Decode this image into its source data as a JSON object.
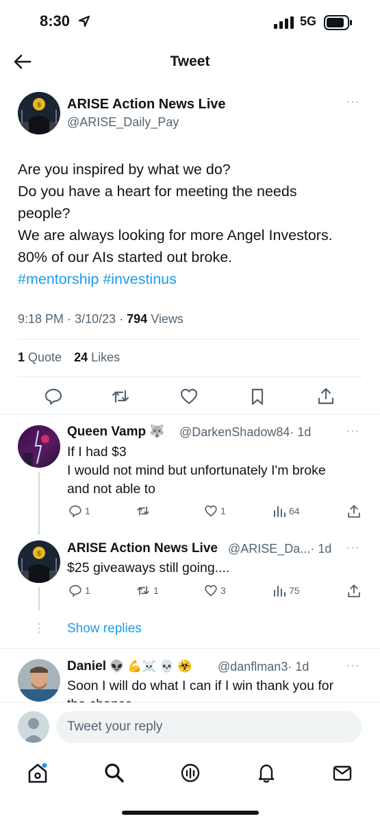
{
  "status_bar": {
    "time": "8:30",
    "network": "5G"
  },
  "header": {
    "title": "Tweet"
  },
  "tweet": {
    "author_name": "ARISE Action News Live",
    "author_handle": "@ARISE_Daily_Pay",
    "lines": [
      "Are you inspired by what we do?",
      "Do you have a heart for meeting the needs",
      "people?",
      "We are always looking for more Angel Investors.",
      "80% of our AIs started out broke."
    ],
    "hashtags": [
      "#mentorship",
      "#investinus"
    ],
    "time": "9:18 PM",
    "date": "3/10/23",
    "views_count": "794",
    "views_label": "Views",
    "quotes_count": "1",
    "quotes_label": "Quote",
    "likes_count": "24",
    "likes_label": "Likes"
  },
  "replies": [
    {
      "name": "Queen Vamp",
      "emoji": "🐺",
      "handle": "@DarkenShadow84",
      "age": "· 1d",
      "lines": [
        "If I had $3",
        "I would not mind but unfortunately I'm broke",
        "and not able to"
      ],
      "reply_count": "1",
      "retweet_count": "",
      "like_count": "1",
      "view_count": "64"
    },
    {
      "name": "ARISE Action News Live",
      "handle": "@ARISE_Da...",
      "age": "· 1d",
      "lines": [
        "$25 giveaways still going...."
      ],
      "reply_count": "1",
      "retweet_count": "1",
      "like_count": "3",
      "view_count": "75"
    },
    {
      "name": "Daniel",
      "emoji": "👽 💪☠️ 💀 ☣️",
      "handle": "@danflman3",
      "age": "· 1d",
      "lines": [
        "Soon I will do what I can if I win thank you for",
        "the chance"
      ]
    }
  ],
  "show_replies": "Show replies",
  "compose": {
    "placeholder": "Tweet your reply"
  },
  "colors": {
    "accent": "#1d9bf0",
    "text": "#0f1419",
    "secondary": "#536471"
  },
  "icons": [
    "back-arrow-icon",
    "more-icon",
    "reply-icon",
    "retweet-icon",
    "like-icon",
    "bookmark-icon",
    "share-icon",
    "views-icon",
    "home-icon",
    "search-icon",
    "spaces-icon",
    "notifications-icon",
    "messages-icon"
  ]
}
